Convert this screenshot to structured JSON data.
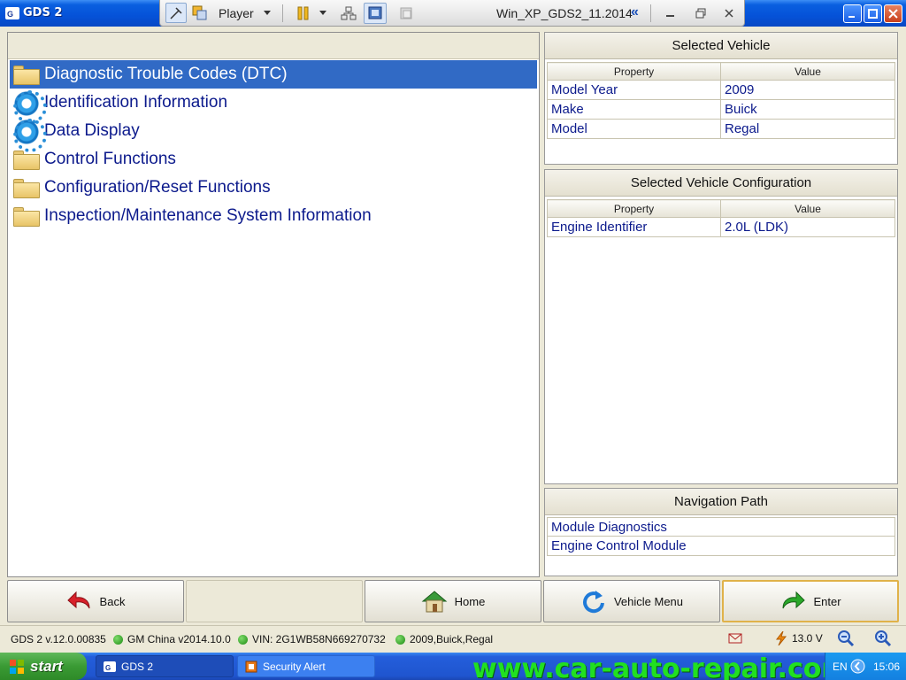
{
  "window": {
    "title": "GDS 2"
  },
  "player": {
    "label": "Player",
    "vm_title": "Win_XP_GDS2_11.2014"
  },
  "menu": {
    "items": [
      {
        "label": "Diagnostic Trouble Codes (DTC)",
        "icon": "folder-icon",
        "selected": true
      },
      {
        "label": "Identification Information",
        "icon": "gear-icon"
      },
      {
        "label": "Data Display",
        "icon": "gear-icon"
      },
      {
        "label": "Control Functions",
        "icon": "folder-icon"
      },
      {
        "label": "Configuration/Reset Functions",
        "icon": "folder-icon"
      },
      {
        "label": "Inspection/Maintenance System Information",
        "icon": "folder-icon"
      }
    ]
  },
  "selected_vehicle": {
    "title": "Selected Vehicle",
    "col_property": "Property",
    "col_value": "Value",
    "rows": [
      {
        "property": "Model Year",
        "value": "2009"
      },
      {
        "property": "Make",
        "value": "Buick"
      },
      {
        "property": "Model",
        "value": "Regal"
      }
    ]
  },
  "vehicle_config": {
    "title": "Selected Vehicle Configuration",
    "col_property": "Property",
    "col_value": "Value",
    "rows": [
      {
        "property": "Engine Identifier",
        "value": "2.0L (LDK)"
      }
    ]
  },
  "navigation": {
    "title": "Navigation Path",
    "items": [
      "Module Diagnostics",
      "Engine Control Module"
    ]
  },
  "buttons": {
    "back": "Back",
    "home": "Home",
    "vehicle_menu": "Vehicle Menu",
    "enter": "Enter"
  },
  "status": {
    "version": "GDS 2 v.12.0.00835",
    "region": "GM China v2014.10.0",
    "vin": "VIN: 2G1WB58N669270732",
    "vehicle": "2009,Buick,Regal",
    "voltage": "13.0 V"
  },
  "taskbar": {
    "start": "start",
    "tasks": [
      "GDS 2",
      "Security Alert"
    ],
    "watermark": "www.car-auto-repair.com",
    "lang": "EN",
    "clock": "15:06"
  },
  "colors": {
    "accent": "#316ac5",
    "text_blue": "#0c1a8c",
    "status_green": "#1c8a12"
  }
}
